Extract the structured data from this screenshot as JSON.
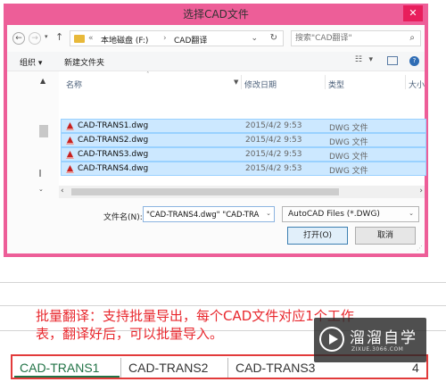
{
  "dialog": {
    "title": "选择CAD文件",
    "close_icon": "close-icon",
    "accent_color": "#ed5e98",
    "address": {
      "overflow": "«",
      "crumbs": [
        "本地磁盘 (F:)",
        "CAD翻译"
      ],
      "search_placeholder": "搜索\"CAD翻译\""
    },
    "toolbar": {
      "organize": "组织 ▾",
      "new_folder": "新建文件夹"
    },
    "columns": {
      "name": "名称",
      "date": "修改日期",
      "type": "类型",
      "size": "大小"
    },
    "files": [
      {
        "name": "CAD-TRANS1.dwg",
        "date": "2015/4/2 9:53",
        "type": "DWG 文件"
      },
      {
        "name": "CAD-TRANS2.dwg",
        "date": "2015/4/2 9:53",
        "type": "DWG 文件"
      },
      {
        "name": "CAD-TRANS3.dwg",
        "date": "2015/4/2 9:53",
        "type": "DWG 文件"
      },
      {
        "name": "CAD-TRANS4.dwg",
        "date": "2015/4/2 9:53",
        "type": "DWG 文件"
      }
    ],
    "filename_label": "文件名(N):",
    "filename_value": "\"CAD-TRANS4.dwg\" \"CAD-TRA",
    "filter": "AutoCAD Files (*.DWG)",
    "open_label": "打开(O)",
    "cancel_label": "取消"
  },
  "caption": {
    "line1": "批量翻译：支持批量导出，每个CAD文件对应1个工作",
    "line2": "表，翻译好后，可以批量导入。"
  },
  "sheet_tabs": [
    "CAD-TRANS1",
    "CAD-TRANS2",
    "CAD-TRANS3",
    "4"
  ],
  "watermark": {
    "name": "溜溜自学",
    "url": "ZIXUE.3066.COM"
  }
}
